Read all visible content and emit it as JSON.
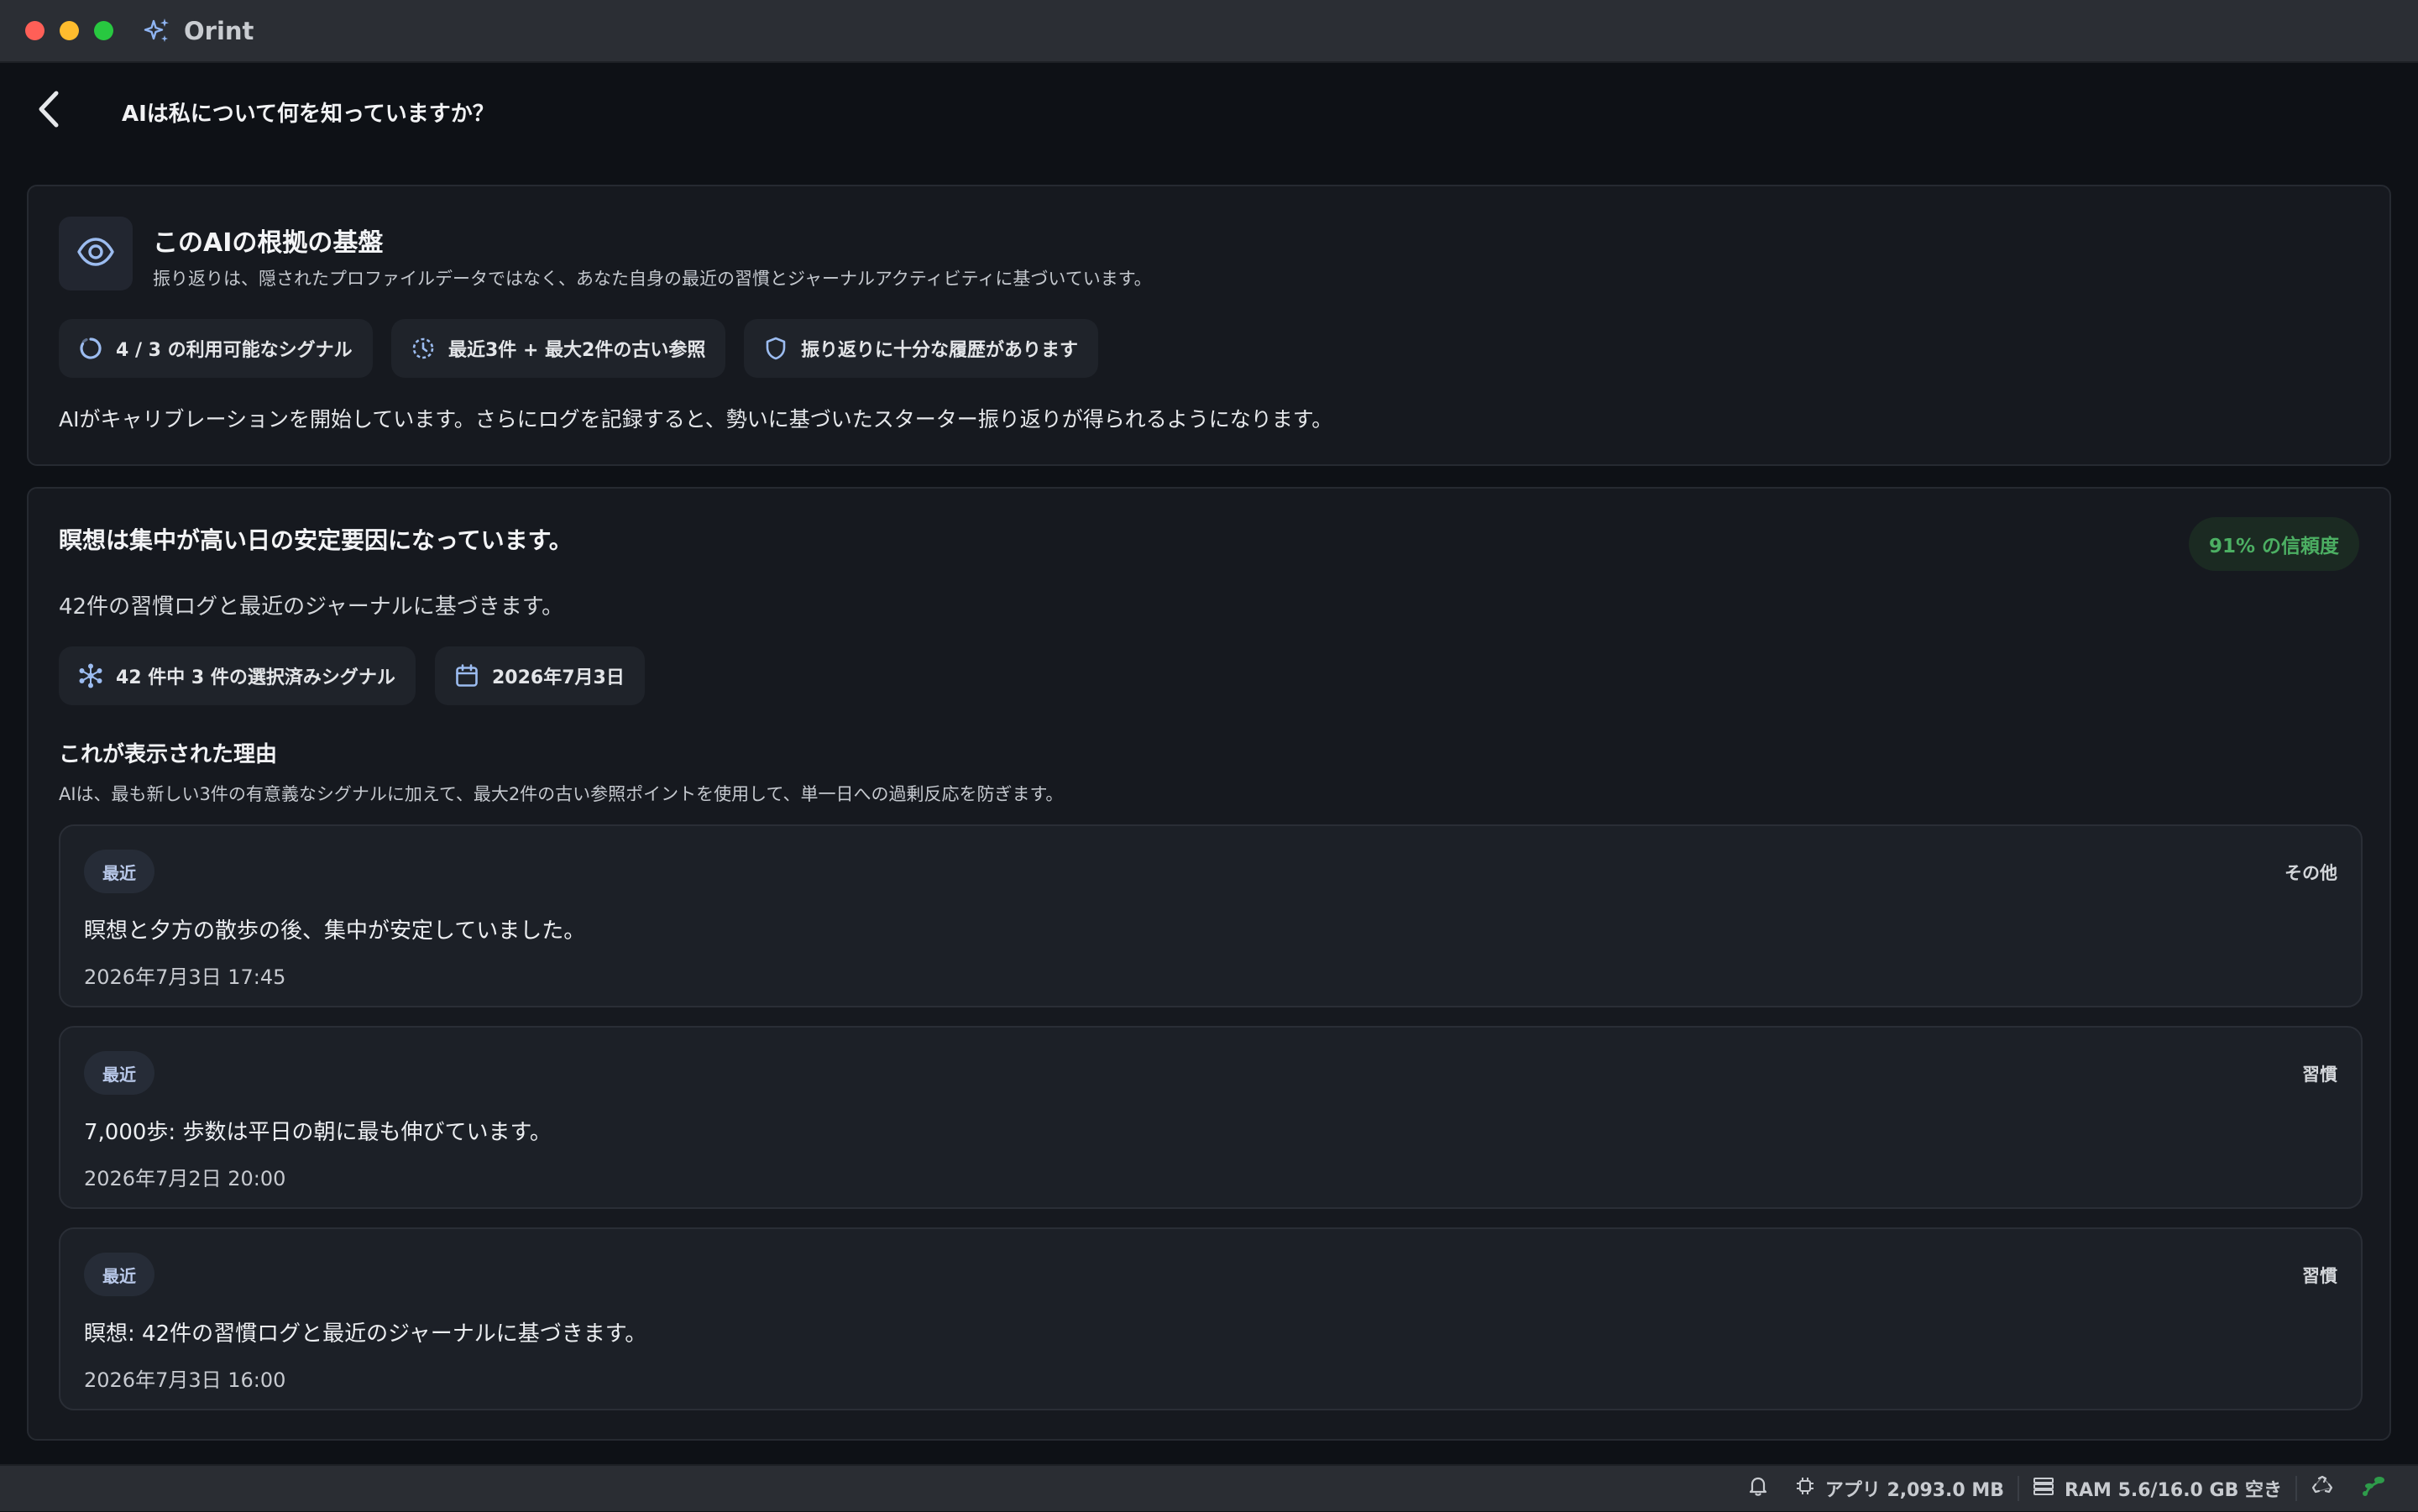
{
  "app": {
    "name": "Orint"
  },
  "header": {
    "title": "AIは私について何を知っていますか？"
  },
  "basis": {
    "title": "このAIの根拠の基盤",
    "subtitle": "振り返りは、隠されたプロファイルデータではなく、あなた自身の最近の習慣とジャーナルアクティビティに基づいています。",
    "chips": [
      {
        "icon": "progress-ring-icon",
        "label": "4 / 3 の利用可能なシグナル"
      },
      {
        "icon": "clock-history-icon",
        "label": "最近3件 + 最大2件の古い参照"
      },
      {
        "icon": "shield-icon",
        "label": "振り返りに十分な履歴があります"
      }
    ],
    "note": "AIがキャリブレーションを開始しています。さらにログを記録すると、勢いに基づいたスターター振り返りが得られるようになります。"
  },
  "insight": {
    "title": "瞑想は集中が高い日の安定要因になっています。",
    "confidence": "91% の信頼度",
    "subtitle": "42件の習慣ログと最近のジャーナルに基づきます。",
    "chips": [
      {
        "icon": "network-icon",
        "label": "42 件中 3 件の選択済みシグナル"
      },
      {
        "icon": "calendar-icon",
        "label": "2026年7月3日"
      }
    ],
    "why_title": "これが表示された理由",
    "why_text": "AIは、最も新しい3件の有意義なシグナルに加えて、最大2件の古い参照ポイントを使用して、単一日への過剰反応を防ぎます。",
    "signals": [
      {
        "tag": "最近",
        "category": "その他",
        "text": "瞑想と夕方の散歩の後、集中が安定していました。",
        "time": "2026年7月3日 17:45"
      },
      {
        "tag": "最近",
        "category": "習慣",
        "text": "7,000歩: 歩数は平日の朝に最も伸びています。",
        "time": "2026年7月2日 20:00"
      },
      {
        "tag": "最近",
        "category": "習慣",
        "text": "瞑想: 42件の習慣ログと最近のジャーナルに基づきます。",
        "time": "2026年7月3日 16:00"
      }
    ]
  },
  "statusbar": {
    "app_memory": "アプリ 2,093.0 MB",
    "ram": "RAM 5.6/16.0 GB 空き"
  },
  "colors": {
    "accent": "#8fb4f2",
    "confidence": "#4caf63"
  }
}
